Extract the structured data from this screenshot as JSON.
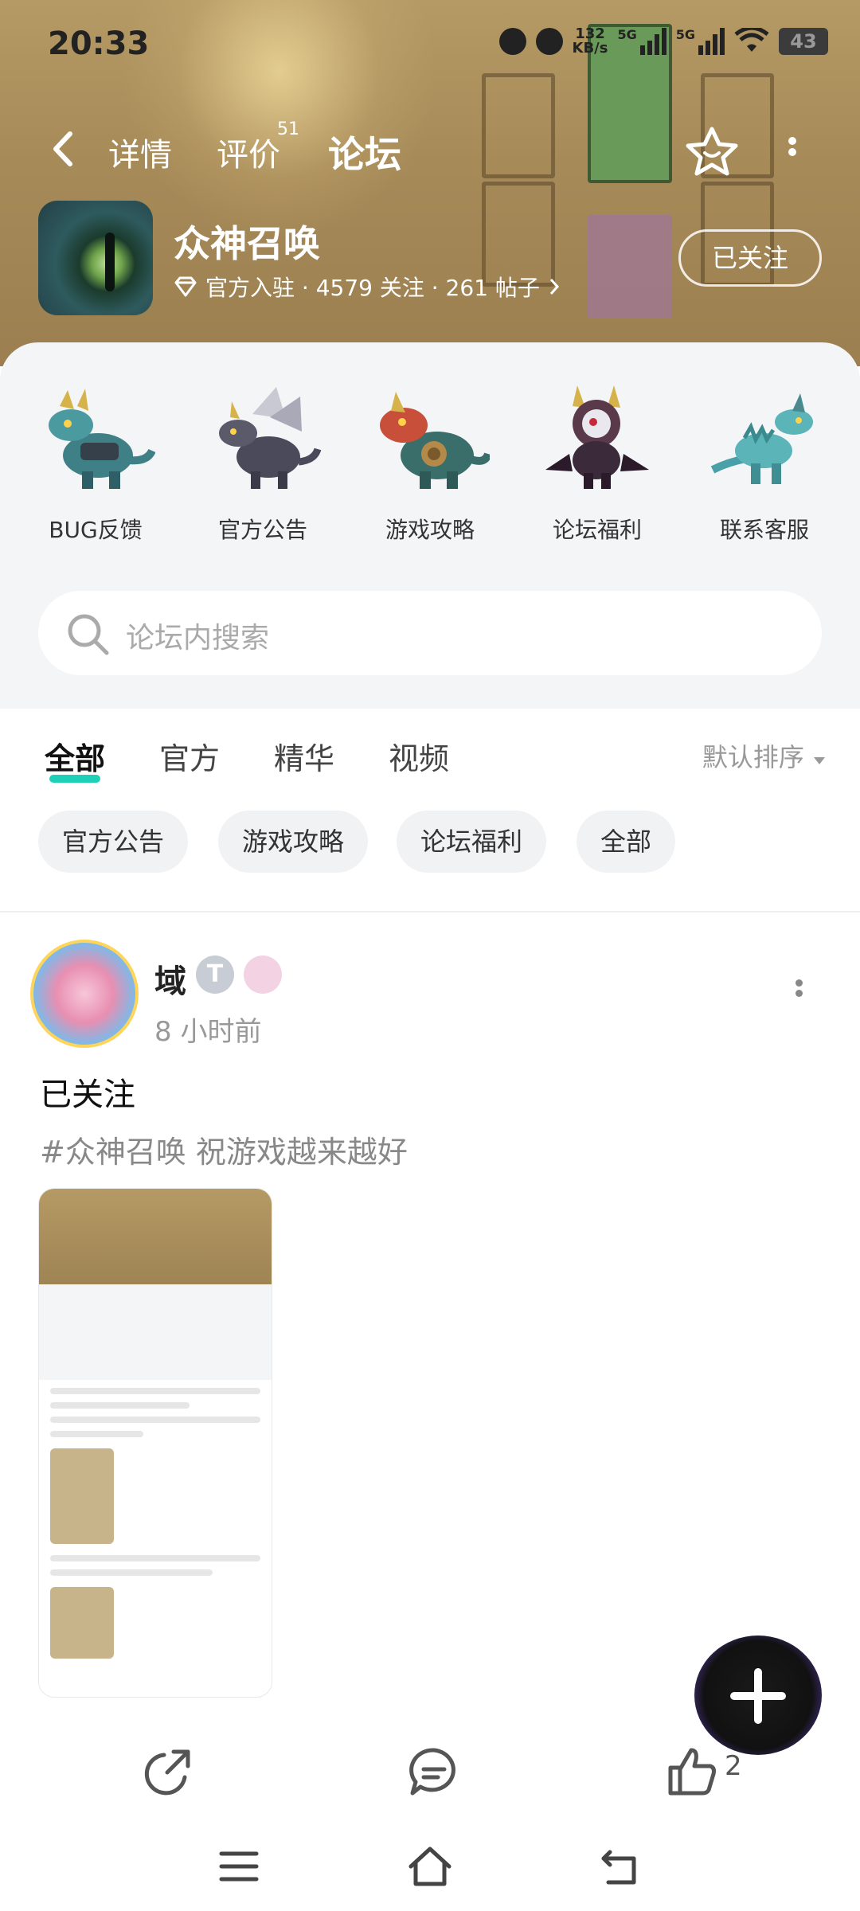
{
  "status": {
    "time": "20:33",
    "net_speed": "132\nKB/s",
    "net_speed_top": "132",
    "net_speed_bottom": "KB/s",
    "sim1": "5G",
    "sim2": "5G",
    "battery": "43"
  },
  "nav": {
    "tabs": [
      "详情",
      "评价",
      "论坛"
    ],
    "active_tab": "论坛",
    "review_count": "51"
  },
  "game": {
    "name": "众神召唤",
    "meta": "官方入驻 · 4579 关注 · 261 帖子",
    "follow_label": "已关注"
  },
  "categories": [
    {
      "label": "BUG反馈"
    },
    {
      "label": "官方公告"
    },
    {
      "label": "游戏攻略"
    },
    {
      "label": "论坛福利"
    },
    {
      "label": "联系客服"
    }
  ],
  "search": {
    "placeholder": "论坛内搜索"
  },
  "filters": {
    "tabs": [
      "全部",
      "官方",
      "精华",
      "视频"
    ],
    "active": "全部",
    "sort_label": "默认排序"
  },
  "chips": [
    "官方公告",
    "游戏攻略",
    "论坛福利",
    "全部"
  ],
  "post": {
    "username": "域",
    "level": "T",
    "time_ago": "8 小时前",
    "title": "已关注",
    "tag_text": "#众神召唤 祝游戏越来越好",
    "likes": "2"
  },
  "colors": {
    "accent": "#1fd0b8",
    "header_bg": "#a68a58",
    "panel_bg": "#f4f5f7"
  }
}
